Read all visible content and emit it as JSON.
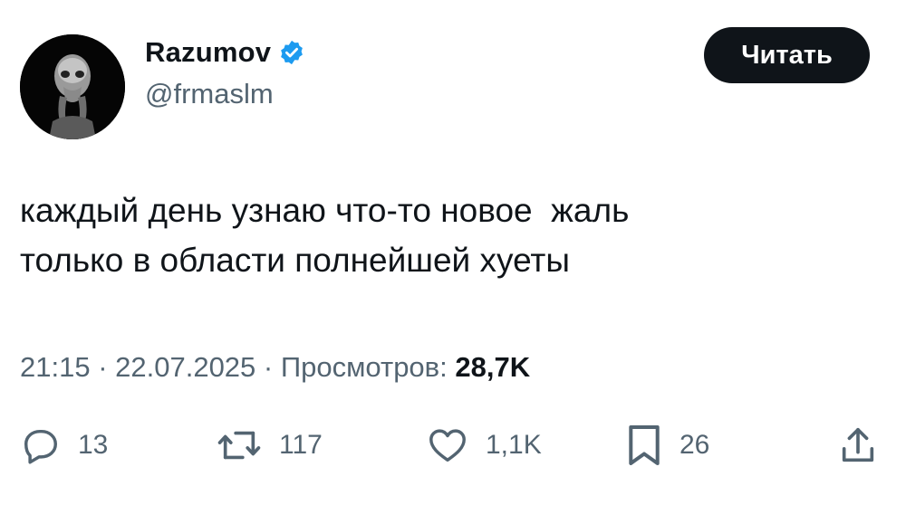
{
  "author": {
    "name": "Razumov",
    "handle": "@frmaslm",
    "verified_color": "#1d9bf0"
  },
  "follow_button": {
    "label": "Читать"
  },
  "tweet": {
    "lines": [
      "каждый день узнаю что-то новое  жаль",
      "только в области полнейшей хуеты"
    ]
  },
  "meta": {
    "time": "21:15",
    "separator": " · ",
    "date": "22.07.2025",
    "views_label": "Просмотров: ",
    "views_count": "28,7K"
  },
  "actions": {
    "replies": "13",
    "reposts": "117",
    "likes": "1,1K",
    "bookmarks": "26"
  },
  "icons": {
    "reply": "reply-icon",
    "repost": "repost-icon",
    "like": "heart-icon",
    "bookmark": "bookmark-icon",
    "share": "share-icon",
    "verified": "verified-badge-icon"
  }
}
